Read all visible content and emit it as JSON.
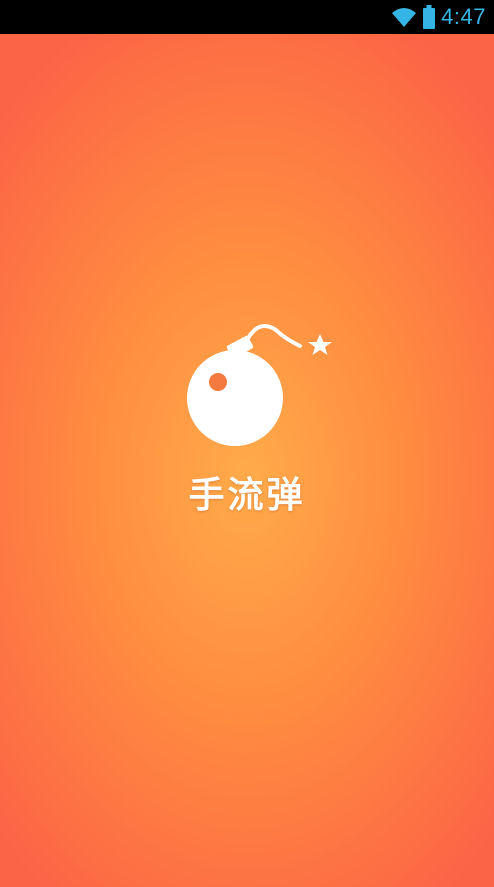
{
  "status_bar": {
    "time": "4:47",
    "icons": [
      "wifi-icon",
      "battery-icon"
    ],
    "accent_color": "#35b5e5"
  },
  "splash": {
    "app_name": "手流弹",
    "logo_icon": "bomb-icon",
    "gradient_colors": [
      "#ffab4a",
      "#ff8c40",
      "#fc6446"
    ]
  }
}
